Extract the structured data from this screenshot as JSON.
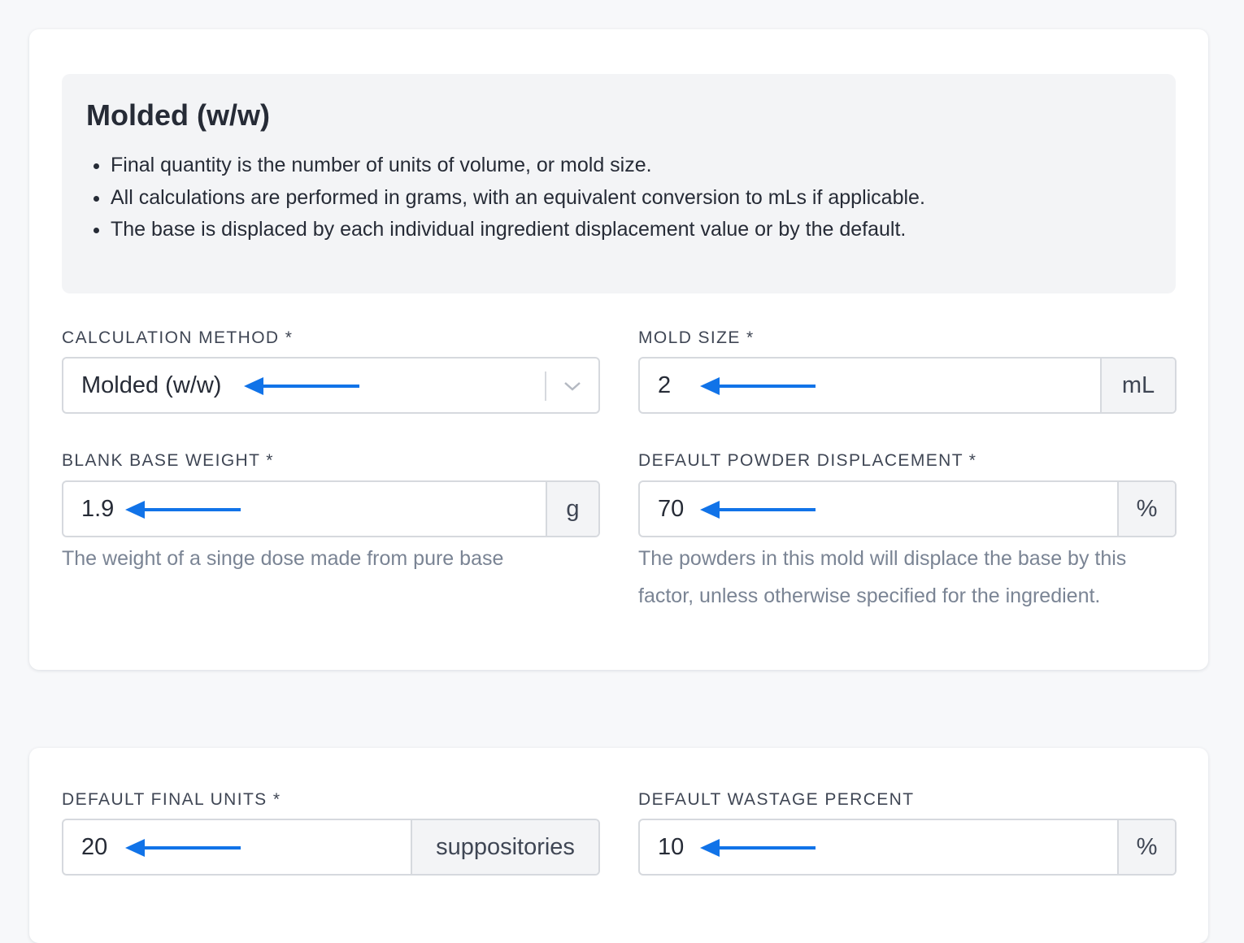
{
  "info": {
    "title": "Molded (w/w)",
    "bullets": [
      "Final quantity is the number of units of volume, or mold size.",
      "All calculations are performed in grams, with an equivalent conversion to mLs if applicable.",
      "The base is displaced by each individual ingredient displacement value or by the default."
    ]
  },
  "fields": {
    "calculation_method": {
      "label": "CALCULATION METHOD *",
      "value": "Molded (w/w)"
    },
    "mold_size": {
      "label": "MOLD SIZE *",
      "value": "2",
      "unit": "mL"
    },
    "blank_base_weight": {
      "label": "BLANK BASE WEIGHT *",
      "value": "1.9",
      "unit": "g",
      "help": "The weight of a singe dose made from pure base"
    },
    "default_powder_displacement": {
      "label": "DEFAULT POWDER DISPLACEMENT *",
      "value": "70",
      "unit": "%",
      "help": "The powders in this mold will displace the base by this factor, unless otherwise specified for the ingredient."
    },
    "default_final_units": {
      "label": "DEFAULT FINAL UNITS *",
      "value": "20",
      "unit": "suppositories"
    },
    "default_wastage_percent": {
      "label": "DEFAULT WASTAGE PERCENT",
      "value": "10",
      "unit": "%"
    }
  },
  "icons": {
    "select": "chevron-down-icon",
    "annotation": "arrow-left-icon"
  },
  "colors": {
    "annotation_arrow": "#1173e8",
    "page_background": "#f7f8fa",
    "info_background": "#f3f4f6",
    "help_text": "#7a8494"
  }
}
